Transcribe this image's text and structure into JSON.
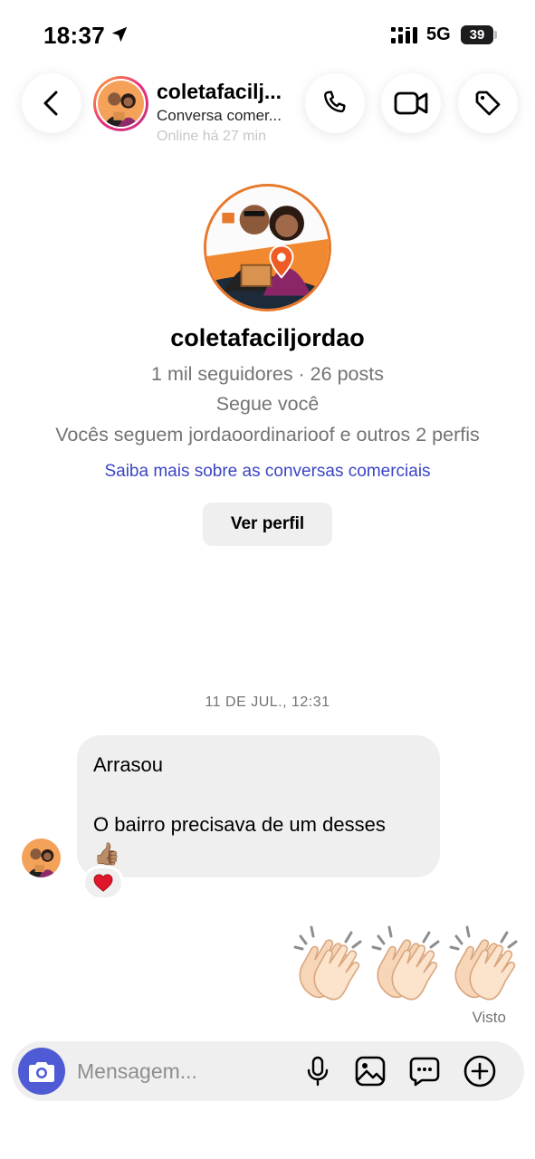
{
  "status_bar": {
    "time": "18:37",
    "network": "5G",
    "battery": "39"
  },
  "header": {
    "name": "coletafacilj...",
    "subtitle": "Conversa comer...",
    "online": "Online há 27 min"
  },
  "profile": {
    "username": "coletafaciljordao",
    "stats": "1 mil seguidores · 26 posts",
    "follows_you": "Segue você",
    "mutual": "Vocês seguem jordaoordinarioof e outros 2 perfis",
    "info_link": "Saiba mais sobre as conversas comerciais",
    "view_profile_label": "Ver perfil"
  },
  "thread": {
    "date": "11 DE JUL., 12:31",
    "incoming": {
      "line1": "Arrasou",
      "line2": "O bairro precisava de um desses",
      "emoji": "👍🏽",
      "reaction": "❤️"
    },
    "outgoing": {
      "emoji": "👏🏻👏🏻👏🏻",
      "status": "Visto"
    }
  },
  "composer": {
    "placeholder": "Mensagem..."
  },
  "colors": {
    "accent_blue": "#4f5bd5",
    "link": "#3b45c4",
    "bubble_bg": "#efefef",
    "brand_orange": "#e8782a"
  }
}
